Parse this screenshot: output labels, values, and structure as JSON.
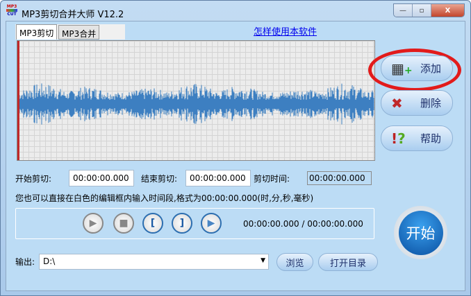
{
  "window": {
    "title": "MP3剪切合并大师 V12.2",
    "logo_text": "MP3 CUT",
    "minimize": "—",
    "maximize": "▫",
    "close": "X"
  },
  "tabs": [
    {
      "label": "MP3剪切",
      "active": true
    },
    {
      "label": "MP3合并",
      "active": false
    }
  ],
  "help_link": "怎样使用本软件",
  "side_buttons": {
    "add": "添加",
    "delete": "删除",
    "help": "帮助"
  },
  "cut": {
    "start_label": "开始剪切:",
    "start_value": "00:00:00.000",
    "end_label": "结束剪切:",
    "end_value": "00:00:00.000",
    "duration_label": "剪切时间:",
    "duration_value": "00:00:00.000"
  },
  "hint": "您也可以直接在白色的编辑框内输入时间段,格式为00:00:00.000(时,分,秒,毫秒)",
  "player": {
    "time": "00:00:00.000 / 00:00:00.000"
  },
  "start_button": "开始",
  "output": {
    "label": "输出:",
    "value": "D:\\",
    "browse": "浏览",
    "open_dir": "打开目录"
  },
  "colors": {
    "highlight": "#e21b1b",
    "wave": "#3d7fc1"
  }
}
